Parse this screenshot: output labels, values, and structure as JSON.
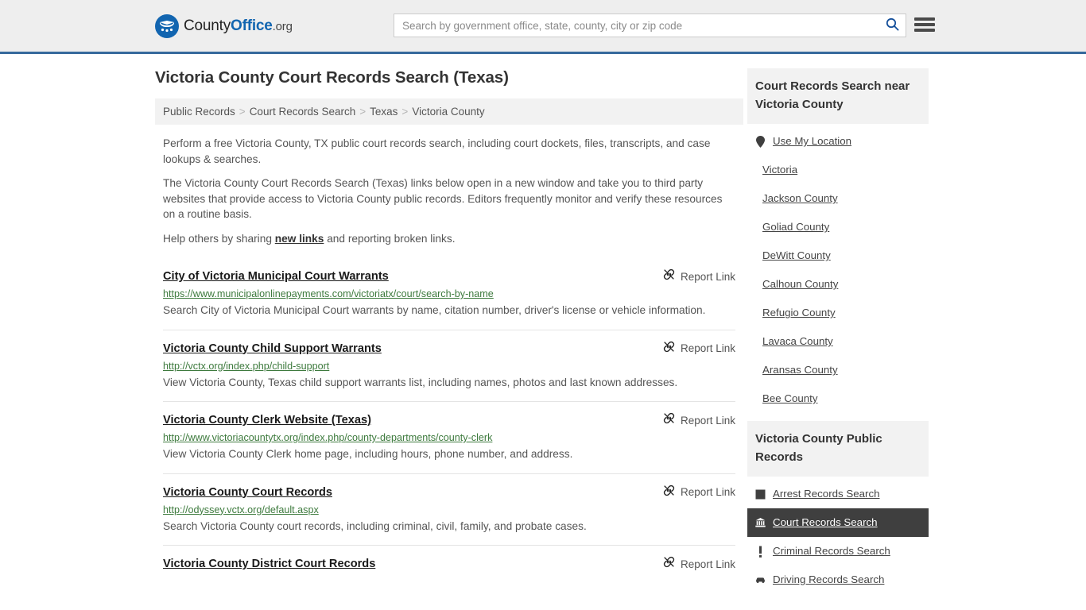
{
  "header": {
    "logo": {
      "icon": "eagle-shield-icon",
      "text_part1": "County",
      "text_part2": "Office",
      "text_part3": ".org"
    },
    "search": {
      "placeholder": "Search by government office, state, county, city or zip code",
      "value": "",
      "search_icon": "search-icon"
    },
    "menu_icon": "hamburger-menu-icon",
    "accent_color": "#36699c",
    "background_color": "#eeeeee"
  },
  "main": {
    "title": "Victoria County Court Records Search (Texas)",
    "breadcrumb": {
      "separator": ">",
      "items": [
        {
          "label": "Public Records"
        },
        {
          "label": "Court Records Search"
        },
        {
          "label": "Texas"
        },
        {
          "label": "Victoria County"
        }
      ]
    },
    "intro": {
      "p1": "Perform a free Victoria County, TX public court records search, including court dockets, files, transcripts, and case lookups & searches.",
      "p2": "The Victoria County Court Records Search (Texas) links below open in a new window and take you to third party websites that provide access to Victoria County public records. Editors frequently monitor and verify these resources on a routine basis.",
      "p3_before": "Help others by sharing ",
      "p3_link": "new links",
      "p3_after": " and reporting broken links."
    },
    "report_link_label": "Report Link",
    "report_link_icon": "broken-link-icon",
    "results": [
      {
        "title": "City of Victoria Municipal Court Warrants",
        "url": "https://www.municipalonlinepayments.com/victoriatx/court/search-by-name",
        "description": "Search City of Victoria Municipal Court warrants by name, citation number, driver's license or vehicle information."
      },
      {
        "title": "Victoria County Child Support Warrants",
        "url": "http://vctx.org/index.php/child-support",
        "description": "View Victoria County, Texas child support warrants list, including names, photos and last known addresses."
      },
      {
        "title": "Victoria County Clerk Website (Texas)",
        "url": "http://www.victoriacountytx.org/index.php/county-departments/county-clerk",
        "description": "View Victoria County Clerk home page, including hours, phone number, and address."
      },
      {
        "title": "Victoria County Court Records",
        "url": "http://odyssey.vctx.org/default.aspx",
        "description": "Search Victoria County court records, including criminal, civil, family, and probate cases."
      },
      {
        "title": "Victoria County District Court Records",
        "url": "",
        "description": ""
      }
    ]
  },
  "sidebar": {
    "nearby": {
      "heading": "Court Records Search near Victoria County",
      "items": [
        {
          "label": "Use My Location",
          "icon": "map-pin-icon"
        },
        {
          "label": "Victoria",
          "icon": ""
        },
        {
          "label": "Jackson County",
          "icon": ""
        },
        {
          "label": "Goliad County",
          "icon": ""
        },
        {
          "label": "DeWitt County",
          "icon": ""
        },
        {
          "label": "Calhoun County",
          "icon": ""
        },
        {
          "label": "Refugio County",
          "icon": ""
        },
        {
          "label": "Lavaca County",
          "icon": ""
        },
        {
          "label": "Aransas County",
          "icon": ""
        },
        {
          "label": "Bee County",
          "icon": ""
        }
      ]
    },
    "public_records": {
      "heading": "Victoria County Public Records",
      "active_index": 1,
      "items": [
        {
          "label": "Arrest Records Search",
          "icon": "building-icon"
        },
        {
          "label": "Court Records Search",
          "icon": "courthouse-icon"
        },
        {
          "label": "Criminal Records Search",
          "icon": "exclamation-icon"
        },
        {
          "label": "Driving Records Search",
          "icon": "car-icon"
        }
      ]
    },
    "active_background_color": "#3f3f3f",
    "heading_background_color": "#f2f2f2"
  }
}
